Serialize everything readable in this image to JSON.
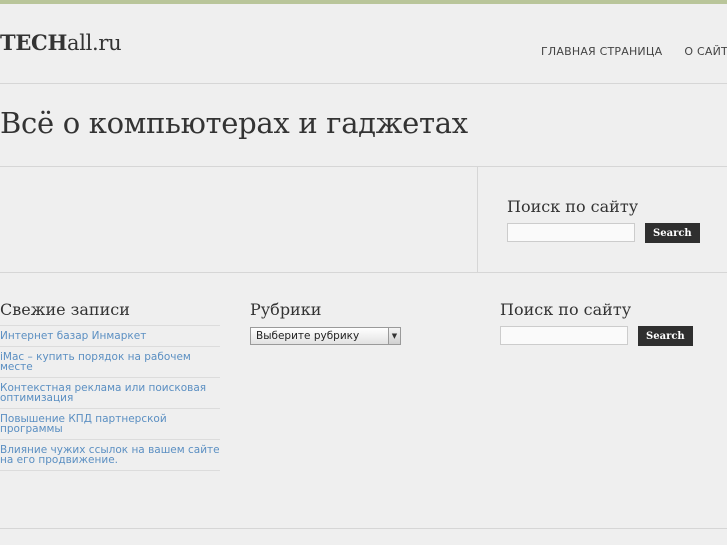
{
  "header": {
    "logo_bold": "TECH",
    "logo_rest": "all.ru",
    "nav": [
      "ГЛАВНАЯ СТРАНИЦА",
      "О САЙТЕ"
    ]
  },
  "page_title": "Всё о компьютерах и гаджетах",
  "top_search": {
    "title": "Поиск по сайту",
    "value": "",
    "button": "Search"
  },
  "recent": {
    "title": "Свежие записи",
    "items": [
      "Интернет базар Инмаркет",
      "iMac – купить порядок на рабочем месте",
      "Контекстная реклама или поисковая оптимизация",
      "Повышение КПД партнерской программы",
      "Влияние чужих ссылок на вашем сайте на его продвижение."
    ]
  },
  "categories": {
    "title": "Рубрики",
    "selected": "Выберите рубрику",
    "arrow": "▼"
  },
  "bottom_search": {
    "title": "Поиск по сайту",
    "value": "",
    "button": "Search"
  }
}
